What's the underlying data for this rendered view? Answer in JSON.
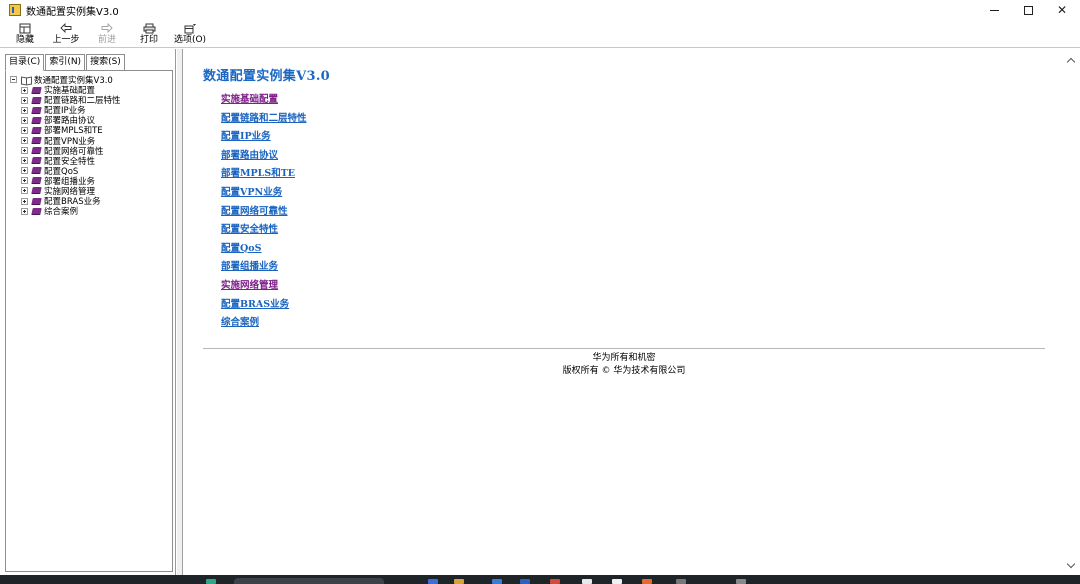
{
  "window": {
    "title": "数通配置实例集V3.0",
    "controls": {
      "minimize": "minimize",
      "maximize": "maximize",
      "close": "✕"
    }
  },
  "toolbar": {
    "hide_label": "隐藏",
    "back_label": "上一步",
    "forward_label": "前进",
    "print_label": "打印",
    "options_label": "选项(O)"
  },
  "nav": {
    "tabs": [
      {
        "label": "目录(C)",
        "active": true
      },
      {
        "label": "索引(N)",
        "active": false
      },
      {
        "label": "搜索(S)",
        "active": false
      }
    ],
    "tree_root": "数通配置实例集V3.0",
    "tree_items": [
      "实施基础配置",
      "配置链路和二层特性",
      "配置IP业务",
      "部署路由协议",
      "部署MPLS和TE",
      "配置VPN业务",
      "配置网络可靠性",
      "配置安全特性",
      "配置QoS",
      "部署组播业务",
      "实施网络管理",
      "配置BRAS业务",
      "综合案例"
    ]
  },
  "content": {
    "title": "数通配置实例集V3.0",
    "links": [
      {
        "label": "实施基础配置",
        "visited": true
      },
      {
        "label": "配置链路和二层特性",
        "visited": false
      },
      {
        "label": "配置IP业务",
        "visited": false
      },
      {
        "label": "部署路由协议",
        "visited": false
      },
      {
        "label": "部署MPLS和TE",
        "visited": false
      },
      {
        "label": "配置VPN业务",
        "visited": false
      },
      {
        "label": "配置网络可靠性",
        "visited": false
      },
      {
        "label": "配置安全特性",
        "visited": false
      },
      {
        "label": "配置QoS",
        "visited": false
      },
      {
        "label": "部署组播业务",
        "visited": false
      },
      {
        "label": "实施网络管理",
        "visited": true
      },
      {
        "label": "配置BRAS业务",
        "visited": false
      },
      {
        "label": "综合案例",
        "visited": false
      }
    ],
    "footer_line1": "华为所有和机密",
    "footer_line2": "版权所有 © 华为技术有限公司"
  },
  "colors": {
    "link": "#1a64c0",
    "visited_link": "#7e1f8a",
    "title": "#1a68c4",
    "book_icon": "#7b2d87"
  }
}
